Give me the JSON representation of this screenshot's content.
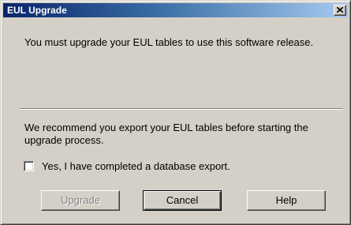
{
  "dialog": {
    "title": "EUL Upgrade",
    "message": "You must upgrade your EUL tables to use this software release.",
    "recommendation": "We recommend you export your EUL tables before starting the upgrade process.",
    "checkbox": {
      "label": "Yes, I have completed a database export.",
      "checked": false
    },
    "buttons": {
      "upgrade": "Upgrade",
      "cancel": "Cancel",
      "help": "Help"
    }
  },
  "colors": {
    "dialog_face": "#d4d0c8",
    "titlebar_start": "#0a246a",
    "titlebar_end": "#a6caf0",
    "disabled_text": "#808080"
  }
}
